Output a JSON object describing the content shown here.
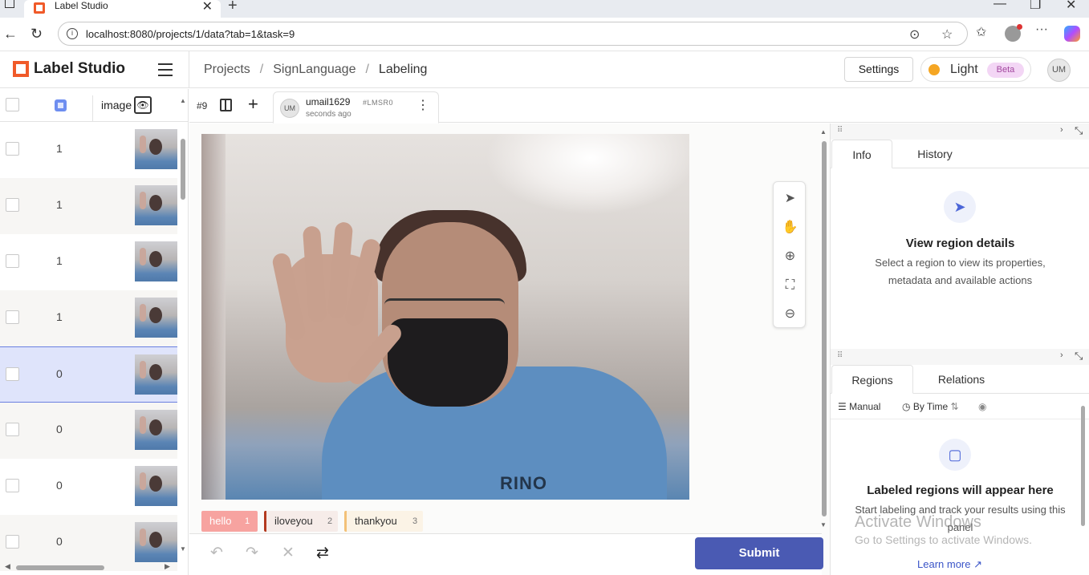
{
  "browser": {
    "tab_title": "Label Studio",
    "url": "localhost:8080/projects/1/data?tab=1&task=9"
  },
  "header": {
    "logo_text": "Label Studio",
    "breadcrumbs": [
      "Projects",
      "SignLanguage",
      "Labeling"
    ],
    "settings_label": "Settings",
    "theme_label": "Light",
    "beta_label": "Beta",
    "avatar_initials": "UM"
  },
  "datalist": {
    "column_name": "image",
    "rows": [
      {
        "value": "1",
        "selected": false
      },
      {
        "value": "1",
        "selected": false
      },
      {
        "value": "1",
        "selected": false
      },
      {
        "value": "1",
        "selected": false
      },
      {
        "value": "0",
        "selected": true
      },
      {
        "value": "0",
        "selected": false
      },
      {
        "value": "0",
        "selected": false
      },
      {
        "value": "0",
        "selected": false
      }
    ]
  },
  "task": {
    "id": "#9",
    "annotation": {
      "avatar": "UM",
      "user": "umail1629",
      "code": "#LMSR0",
      "time": "seconds ago"
    }
  },
  "image": {
    "shirt_text": "RINO"
  },
  "labels": [
    {
      "name": "hello",
      "key": "1",
      "color": "#f7a3a0"
    },
    {
      "name": "iloveyou",
      "key": "2",
      "color": "#b33a1f"
    },
    {
      "name": "thankyou",
      "key": "3",
      "color": "#f3c178"
    }
  ],
  "actions": {
    "submit_label": "Submit"
  },
  "info_panel": {
    "tabs": [
      "Info",
      "History"
    ],
    "empty_title": "View region details",
    "empty_desc": "Select a region to view its properties, metadata and available actions"
  },
  "regions_panel": {
    "tabs": [
      "Regions",
      "Relations"
    ],
    "manual_label": "Manual",
    "bytime_label": "By Time",
    "empty_title": "Labeled regions will appear here",
    "empty_desc": "Start labeling and track your results using this panel",
    "learn_more": "Learn more"
  },
  "watermark": {
    "line1": "Activate Windows",
    "line2": "Go to Settings to activate Windows."
  }
}
